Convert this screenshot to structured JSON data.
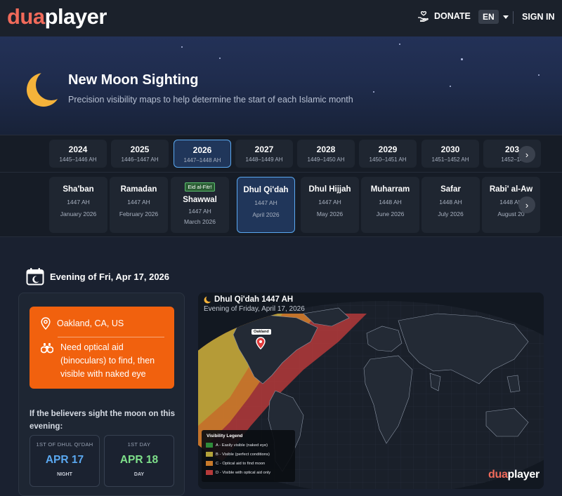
{
  "header": {
    "logo_part1": "dua",
    "logo_part2": "player",
    "donate_label": "DONATE",
    "language": "EN",
    "signin_label": "SIGN IN"
  },
  "hero": {
    "title": "New Moon Sighting",
    "subtitle": "Precision visibility maps to help determine the start of each Islamic month"
  },
  "years": [
    {
      "year": "2024",
      "ah": "1445–1446 AH",
      "active": false
    },
    {
      "year": "2025",
      "ah": "1446–1447 AH",
      "active": false
    },
    {
      "year": "2026",
      "ah": "1447–1448 AH",
      "active": true
    },
    {
      "year": "2027",
      "ah": "1448–1449 AH",
      "active": false
    },
    {
      "year": "2028",
      "ah": "1449–1450 AH",
      "active": false
    },
    {
      "year": "2029",
      "ah": "1450–1451 AH",
      "active": false
    },
    {
      "year": "2030",
      "ah": "1451–1452 AH",
      "active": false
    },
    {
      "year": "203",
      "ah": "1452–14",
      "active": false
    }
  ],
  "months": [
    {
      "name": "Sha'ban",
      "ah": "1447 AH",
      "greg": "January 2026",
      "badge": "",
      "active": false
    },
    {
      "name": "Ramadan",
      "ah": "1447 AH",
      "greg": "February 2026",
      "badge": "",
      "active": false
    },
    {
      "name": "Shawwal",
      "ah": "1447 AH",
      "greg": "March 2026",
      "badge": "Eid al-Fitr!",
      "active": false
    },
    {
      "name": "Dhul Qi'dah",
      "ah": "1447 AH",
      "greg": "April 2026",
      "badge": "",
      "active": true
    },
    {
      "name": "Dhul Hijjah",
      "ah": "1447 AH",
      "greg": "May 2026",
      "badge": "",
      "active": false
    },
    {
      "name": "Muharram",
      "ah": "1448 AH",
      "greg": "June 2026",
      "badge": "",
      "active": false
    },
    {
      "name": "Safar",
      "ah": "1448 AH",
      "greg": "July 2026",
      "badge": "",
      "active": false
    },
    {
      "name": "Rabi' al-Aw",
      "ah": "1448 AH",
      "greg": "August 20",
      "badge": "",
      "active": false
    }
  ],
  "evening": {
    "label": "Evening of Fri, Apr 17, 2026"
  },
  "result": {
    "location": "Oakland, CA, US",
    "message": "Need optical aid (binoculars) to find, then visible with naked eye",
    "accent": "#f1610e",
    "believers_text": "If the believers sight the moon on this evening:",
    "cards": [
      {
        "heading": "1ST OF DHUL QI'DAH",
        "value": "APR 17",
        "footer": "NIGHT",
        "color": "#5aa8f0"
      },
      {
        "heading": "1ST DAY",
        "value": "APR 18",
        "footer": "DAY",
        "color": "#7ee08a"
      }
    ]
  },
  "map": {
    "title": "Dhul Qi'dah 1447 AH",
    "subtitle": "Evening of Friday, April 17, 2026",
    "pin_label": "Oakland",
    "legend_title": "Visibility Legend",
    "legend": [
      {
        "label": "A - Easily visible (naked eye)",
        "color": "#2e8b3a"
      },
      {
        "label": "B - Visible (perfect conditions)",
        "color": "#b3a23a"
      },
      {
        "label": "C - Optical aid to find moon",
        "color": "#c87a2a"
      },
      {
        "label": "D - Visible with optical aid only",
        "color": "#b53a3a"
      }
    ],
    "watermark_part1": "dua",
    "watermark_part2": "player"
  }
}
